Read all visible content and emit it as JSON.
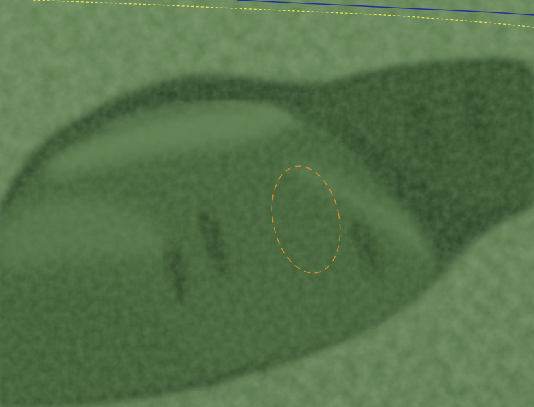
{
  "scene": {
    "view": "3d-terrain-perspective",
    "colors": {
      "plain": "#587a48",
      "plain_light": "#6f9160",
      "ridge_shadow": "#2c4526",
      "ridge_mid": "#3f5e35",
      "ridge_light": "#6b8d5b",
      "highlight": "#8eae7c"
    }
  },
  "overlays": {
    "boundary_line": {
      "color": "#e6e64a",
      "style": "dashed"
    },
    "blue_line": {
      "color": "#1f2fa0",
      "style": "solid"
    },
    "selection_ellipse": {
      "color": "#e08a2a",
      "style": "dashed"
    }
  }
}
